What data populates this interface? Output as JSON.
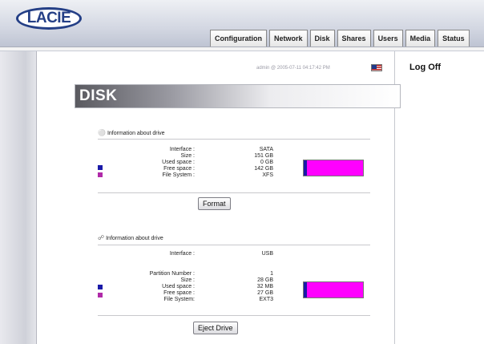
{
  "header": {
    "logo": "LACIE"
  },
  "tabs": [
    "Configuration",
    "Network",
    "Disk",
    "Shares",
    "Users",
    "Media",
    "Status"
  ],
  "user_line": "admin @ 2005-07-11 04:17:42 PM",
  "logoff_label": "Log Off",
  "page_title": "DISK",
  "colors": {
    "used": "#1a1aa8",
    "free": "#ff00ff",
    "swatch_used": "#1a1aa8",
    "swatch_free": "#b02aa8"
  },
  "drives": [
    {
      "heading": "Information about drive",
      "icon": "drive-icon",
      "fields": [
        {
          "label": "Interface :",
          "value": "SATA"
        },
        {
          "label": "Size :",
          "value": "151 GB"
        },
        {
          "label": "Used space :",
          "value": "0 GB"
        },
        {
          "label": "Free space :",
          "value": "142 GB"
        },
        {
          "label": "File System :",
          "value": "XFS"
        }
      ],
      "used_fraction": 0.02,
      "button": "Format"
    },
    {
      "heading": "Information about drive",
      "icon": "usb-icon",
      "interface": {
        "label": "Interface :",
        "value": "USB"
      },
      "fields": [
        {
          "label": "Partition Number :",
          "value": "1"
        },
        {
          "label": "Size :",
          "value": "28 GB"
        },
        {
          "label": "Used space :",
          "value": "32 MB"
        },
        {
          "label": "Free space :",
          "value": "27 GB"
        },
        {
          "label": "File System:",
          "value": "EXT3"
        }
      ],
      "used_fraction": 0.02,
      "button": "Eject Drive"
    }
  ]
}
